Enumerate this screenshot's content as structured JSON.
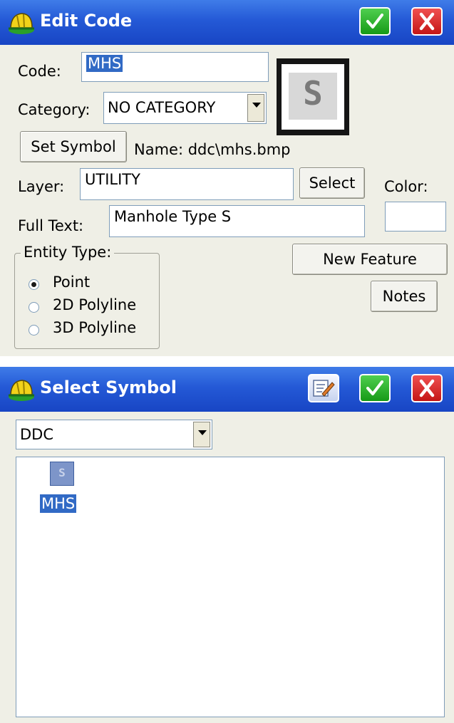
{
  "edit_code": {
    "title": "Edit Code",
    "code_label": "Code:",
    "code_value": "MHS",
    "symbol_glyph": "S",
    "category_label": "Category:",
    "category_value": "NO CATEGORY",
    "set_symbol_label": "Set Symbol",
    "name_text": "Name: ddc\\mhs.bmp",
    "layer_label": "Layer:",
    "layer_value": "UTILITY",
    "select_label": "Select",
    "color_label": "Color:",
    "full_text_label": "Full Text:",
    "full_text_value": "Manhole Type S",
    "entity_type_label": "Entity Type:",
    "entity_options": [
      {
        "label": "Point",
        "selected": true
      },
      {
        "label": "2D Polyline",
        "selected": false
      },
      {
        "label": "3D Polyline",
        "selected": false
      }
    ],
    "new_feature_label": "New Feature",
    "notes_label": "Notes"
  },
  "select_symbol": {
    "title": "Select Symbol",
    "library_value": "DDC",
    "symbols": [
      {
        "label": "MHS",
        "glyph": "S",
        "selected": true
      }
    ]
  },
  "icons": {
    "app": "hardhat-icon",
    "ok": "checkmark-icon",
    "cancel": "close-icon",
    "edit": "edit-note-icon"
  },
  "colors": {
    "titlebar": "#2459d6",
    "ok": "#21a921",
    "cancel": "#d22222",
    "selection": "#316ac5"
  }
}
